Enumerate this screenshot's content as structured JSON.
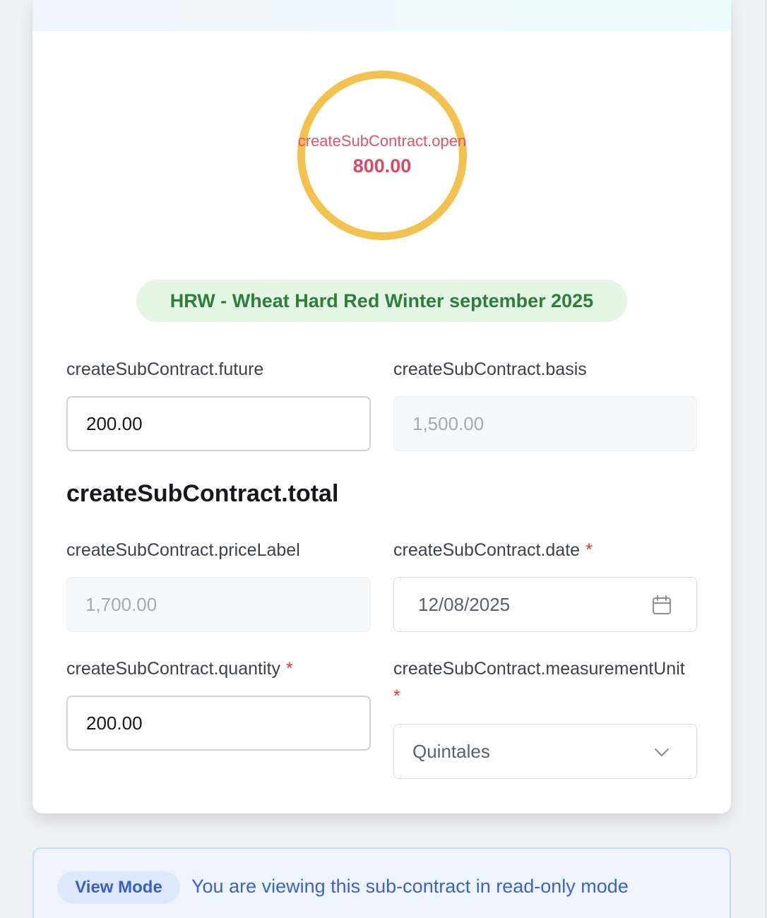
{
  "summary": {
    "open_label": "createSubContract.open",
    "open_value": "800.00",
    "commodity": "HRW - Wheat Hard Red Winter september 2025"
  },
  "fields": {
    "future": {
      "label": "createSubContract.future",
      "value": "200.00"
    },
    "basis": {
      "label": "createSubContract.basis",
      "value": "1,500.00"
    },
    "total_heading": "createSubContract.total",
    "price": {
      "label": "createSubContract.priceLabel",
      "value": "1,700.00"
    },
    "date": {
      "label": "createSubContract.date",
      "required_mark": "*",
      "value": "12/08/2025"
    },
    "quantity": {
      "label": "createSubContract.quantity",
      "required_mark": "*",
      "value": "200.00"
    },
    "measurement_unit": {
      "label": "createSubContract.measurementUnit",
      "required_mark": "*",
      "value": "Quintales"
    }
  },
  "banner": {
    "mode_label": "View Mode",
    "message": "You are viewing this sub-contract in read-only mode"
  },
  "colors": {
    "ring": "#f2c14e",
    "open_text": "#d94a62",
    "commodity_bg": "#e3f7e4",
    "commodity_text": "#2f7d3a",
    "required": "#d9383e",
    "banner_accent": "#3d63c4"
  },
  "icons": {
    "date_trailing": "calendar-icon",
    "unit_trailing": "chevron-down-icon"
  }
}
